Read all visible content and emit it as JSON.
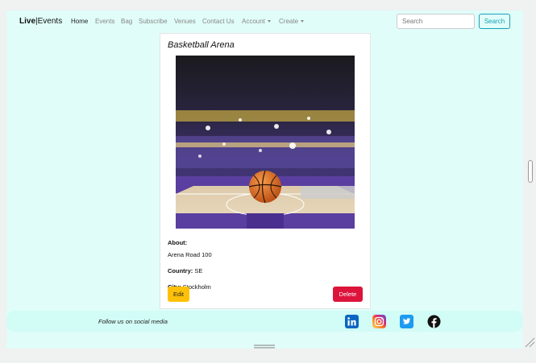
{
  "navbar": {
    "brand_live": "Live",
    "brand_sep": "|",
    "brand_events": "Events",
    "links": [
      "Home",
      "Events",
      "Bag",
      "Subscribe",
      "Venues",
      "Contact Us",
      "Account",
      "Create"
    ],
    "search_placeholder": "Search",
    "search_button": "Search"
  },
  "venue": {
    "title": "Basketball Arena",
    "about_label": "About:",
    "about_value": "Arena Road 100",
    "country_label": "Country:",
    "country_value": "SE",
    "city_label": "City:",
    "city_value": "Stockholm",
    "edit_label": "Edit",
    "delete_label": "Delete"
  },
  "footer": {
    "follow_text": "Follow us on social media",
    "social_icons": [
      "linkedin-icon",
      "instagram-icon",
      "twitter-icon",
      "facebook-icon"
    ]
  },
  "colors": {
    "background": "#e0fdf9",
    "footer": "#d2fcf6",
    "search_accent": "#17a2b8",
    "edit": "#ffc107",
    "delete": "#dc143c"
  }
}
